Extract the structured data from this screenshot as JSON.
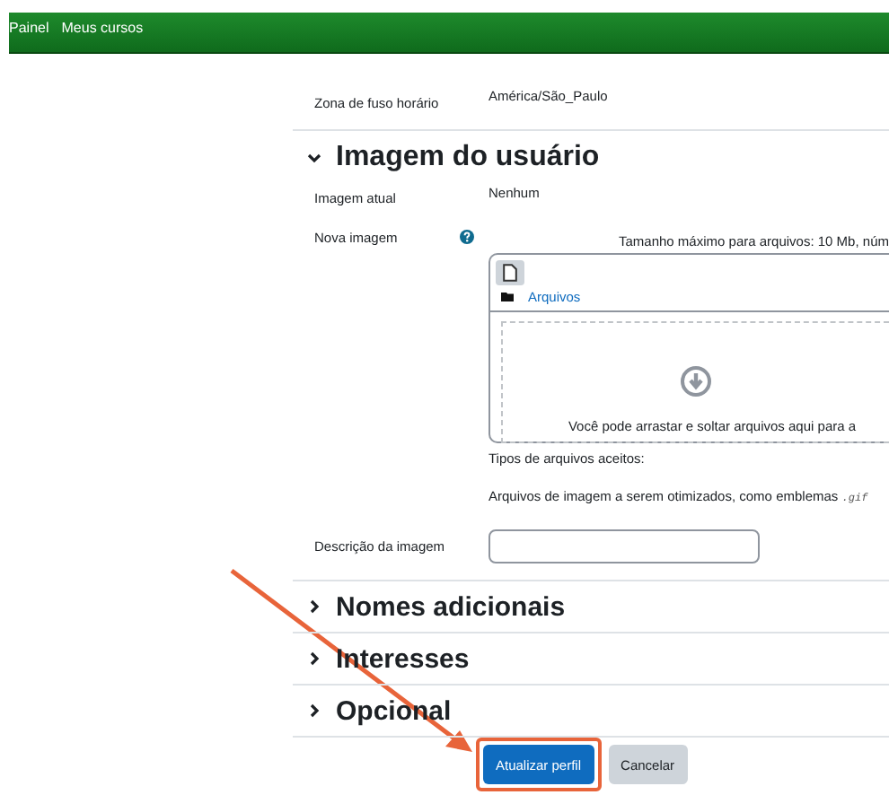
{
  "nav": {
    "items": [
      "Painel",
      "Meus cursos"
    ]
  },
  "timezone": {
    "label": "Zona de fuso horário",
    "value": "América/São_Paulo"
  },
  "sections": [
    {
      "title": "Imagem do usuário",
      "expanded": true
    },
    {
      "title": "Nomes adicionais",
      "expanded": false
    },
    {
      "title": "Interesses",
      "expanded": false
    },
    {
      "title": "Opcional",
      "expanded": false
    }
  ],
  "user_image": {
    "current_label": "Imagem atual",
    "current_value": "Nenhum",
    "new_label": "Nova imagem",
    "max_size": "Tamanho máximo para arquivos: 10 Mb, núm",
    "folder_link": "Arquivos",
    "drop_hint": "Você pode arrastar e soltar arquivos aqui para a",
    "accepted_label": "Tipos de arquivos aceitos:",
    "accepted_types": "Arquivos de imagem a serem otimizados, como emblemas",
    "accepted_ext": ".gif",
    "description_label": "Descrição da imagem"
  },
  "buttons": [
    {
      "label": "Atualizar perfil",
      "kind": "primary",
      "highlighted": true
    },
    {
      "label": "Cancelar",
      "kind": "secondary",
      "highlighted": false
    }
  ]
}
